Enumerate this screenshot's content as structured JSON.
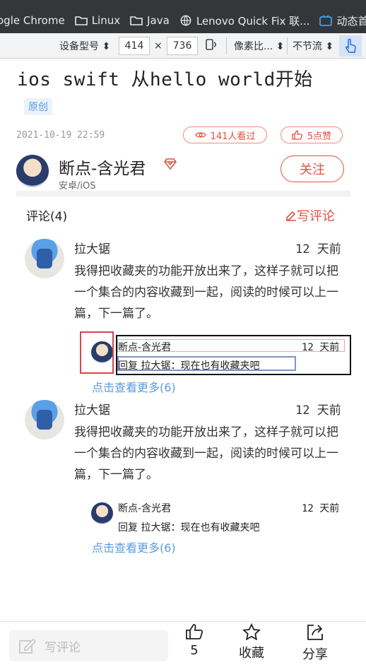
{
  "bookmarks": [
    "ogle Chrome",
    "Linux",
    "Java",
    "Lenovo Quick Fix 联...",
    "动态首"
  ],
  "devtools": {
    "device_label": "设备型号",
    "width": "414",
    "times": "×",
    "height": "736",
    "dpr_label": "像素比...",
    "throttle_label": "不节流"
  },
  "article": {
    "title": "ios swift 从hello world开始",
    "tag": "原创",
    "date": "2021-10-19 22:59",
    "views": "141人看过",
    "likes": "5点赞",
    "author": "断点-含光君",
    "author_sub": "安卓/iOS",
    "follow": "关注"
  },
  "comments": {
    "header": "评论(4)",
    "write": "写评论",
    "items": [
      {
        "name": "拉大锯",
        "time": "12 天前",
        "text": "我得把收藏夹的功能开放出来了，这样子就可以把一个集合的内容收藏到一起，阅读的时候可以上一篇，下一篇了。",
        "reply": {
          "name": "断点-含光君",
          "time": "12 天前",
          "text": "回复 拉大锯：现在也有收藏夹吧"
        },
        "more": "点击查看更多(6)"
      },
      {
        "name": "拉大锯",
        "time": "12 天前",
        "text": "我得把收藏夹的功能开放出来了，这样子就可以把一个集合的内容收藏到一起，阅读的时候可以上一篇，下一篇了。",
        "reply": {
          "name": "断点-含光君",
          "time": "12 天前",
          "text": "回复 拉大锯：现在也有收藏夹吧"
        },
        "more": "点击查看更多(6)"
      }
    ]
  },
  "bottom": {
    "write_placeholder": "写评论",
    "like_count": "5",
    "favorite": "收藏",
    "share": "分享"
  },
  "colors": {
    "accent": "#e0513f",
    "link": "#5a9be0"
  }
}
